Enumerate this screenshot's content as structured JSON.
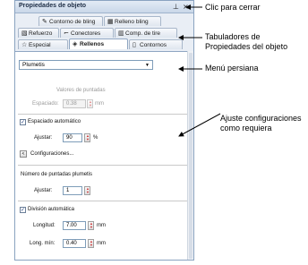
{
  "panel": {
    "title": "Propiedades de objeto",
    "pin_glyph": "⊥",
    "close_glyph": "×"
  },
  "tabs": {
    "row1": [
      "Contorno de bling",
      "Relleno bling"
    ],
    "row2": [
      "Refuerzo",
      "Conectores",
      "Comp. de tire"
    ],
    "row3": [
      "Especial",
      "Rellenos",
      "Contornos"
    ],
    "active": "Rellenos"
  },
  "fill": {
    "type_value": "Plumetis",
    "density_header": "Valores de puntadas",
    "spacing_label": "Espaciado:",
    "spacing_value": "0.38",
    "spacing_unit": "mm",
    "auto_spacing_label": "Espaciado automático",
    "auto_spacing_checked": true,
    "adjust_label": "Ajustar:",
    "adjust_value": "90",
    "adjust_unit": "%",
    "config_button": "<",
    "config_label": "Configuraciones...",
    "plumetis_count_label": "Número de puntadas plumetis",
    "adjust2_label": "Ajustar:",
    "adjust2_value": "1",
    "auto_split_label": "División automática",
    "auto_split_checked": true,
    "length_label": "Longitud:",
    "length_value": "7.00",
    "length_unit": "mm",
    "min_length_label": "Long. mín:",
    "min_length_value": "0.40",
    "min_length_unit": "mm"
  },
  "callouts": {
    "close": "Clic para cerrar",
    "tabs_line1": "Tabuladores de",
    "tabs_line2": "Propiedades del objeto",
    "menu": "Menú persiana",
    "adjust_line1": "Ajuste configuraciones",
    "adjust_line2": "como requiera"
  }
}
